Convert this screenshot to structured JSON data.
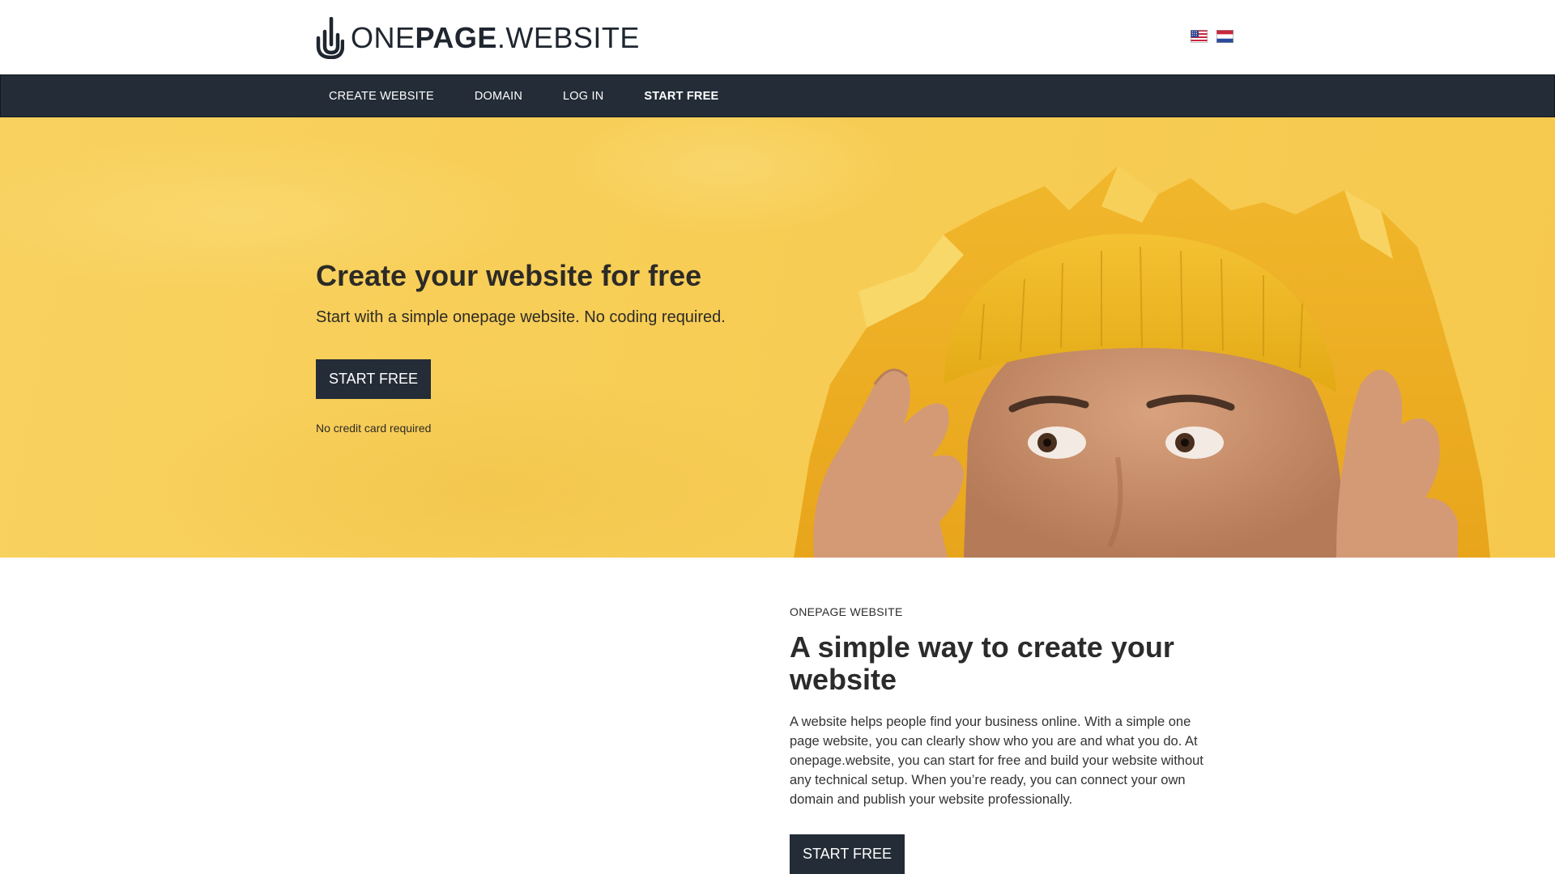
{
  "header": {
    "logo": {
      "prefix": "ONE",
      "bold": "PAGE",
      "suffix": ".WEBSITE"
    },
    "languages": [
      {
        "name": "us-flag-icon",
        "code": "en"
      },
      {
        "name": "nl-flag-icon",
        "code": "nl"
      }
    ]
  },
  "nav": {
    "items": [
      {
        "label": "CREATE WEBSITE"
      },
      {
        "label": "DOMAIN"
      },
      {
        "label": "LOG IN"
      },
      {
        "label": "START FREE"
      }
    ]
  },
  "hero": {
    "title": "Create your website for free",
    "subtitle": "Start with a simple onepage website. No coding required.",
    "cta_label": "START FREE",
    "note": "No credit card required"
  },
  "section": {
    "kicker": "ONEPAGE WEBSITE",
    "title": "A simple way to create your website",
    "body": "A website helps people find your business online. With a simple one page website, you can clearly show who you are and what you do. At onepage.website, you can start for free and build your website without any technical setup. When you’re ready, you can connect your own domain and publish your website professionally.",
    "cta_label": "START FREE"
  },
  "colors": {
    "nav_bg": "#232c37",
    "hero_bg": "#f7cd55",
    "button_bg": "#232c37",
    "text": "#2b2b2b"
  }
}
